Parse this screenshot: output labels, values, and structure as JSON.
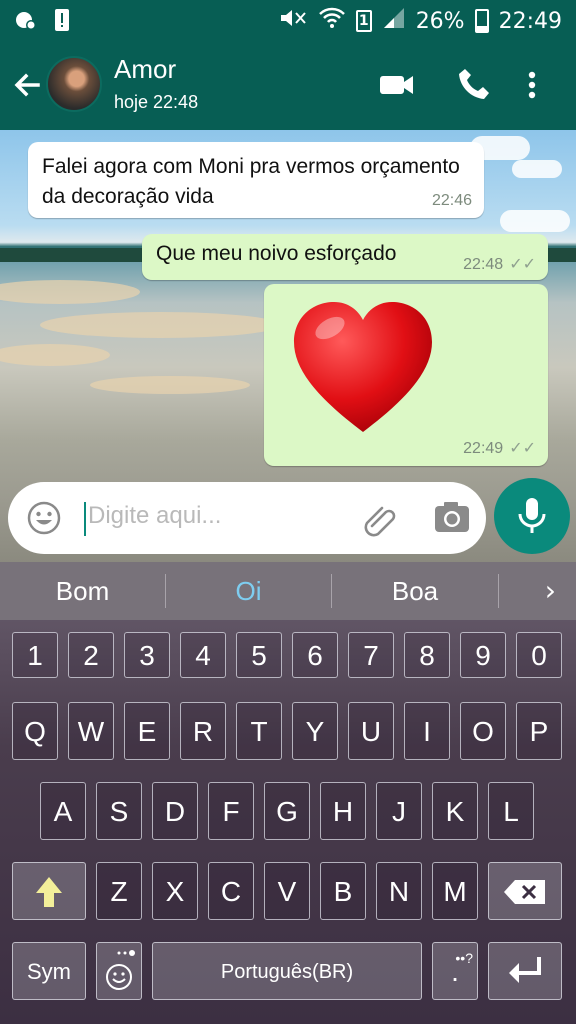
{
  "status_bar": {
    "icons_left": [
      "notification-icon",
      "alert-icon"
    ],
    "icons_right": [
      "mute-icon",
      "wifi-icon",
      "sim-icon",
      "signal-icon"
    ],
    "sim_number": "1",
    "battery_percent": "26%",
    "battery_level": 0.26,
    "time": "22:49"
  },
  "header": {
    "contact_name": "Amor",
    "last_seen": "hoje 22:48"
  },
  "messages": [
    {
      "direction": "in",
      "text": "Falei agora com Moni pra vermos orçamento da decoração vida",
      "time": "22:46"
    },
    {
      "direction": "out",
      "text": "Que meu noivo esforçado",
      "time": "22:48",
      "ticks": "✓✓"
    },
    {
      "direction": "out",
      "emoji": "heart",
      "time": "22:49",
      "ticks": "✓✓"
    }
  ],
  "composer": {
    "placeholder": "Digite aqui..."
  },
  "keyboard": {
    "suggestions": [
      "Bom",
      "Oi",
      "Boa"
    ],
    "active_suggestion": "Oi",
    "more_arrow": "›",
    "number_row": [
      "1",
      "2",
      "3",
      "4",
      "5",
      "6",
      "7",
      "8",
      "9",
      "0"
    ],
    "row1": [
      "Q",
      "W",
      "E",
      "R",
      "T",
      "Y",
      "U",
      "I",
      "O",
      "P"
    ],
    "row2": [
      "A",
      "S",
      "D",
      "F",
      "G",
      "H",
      "J",
      "K",
      "L"
    ],
    "row3": [
      "Z",
      "X",
      "C",
      "V",
      "B",
      "N",
      "M"
    ],
    "sym_label": "Sym",
    "space_label": "Português(BR)",
    "period_label": ".",
    "period_hint": "••?"
  },
  "colors": {
    "header": "#075e54",
    "accent": "#0a8a7c",
    "outgoing_bubble": "#dcf8c6",
    "incoming_bubble": "#ffffff",
    "suggestion_active": "#7ecdf0"
  }
}
